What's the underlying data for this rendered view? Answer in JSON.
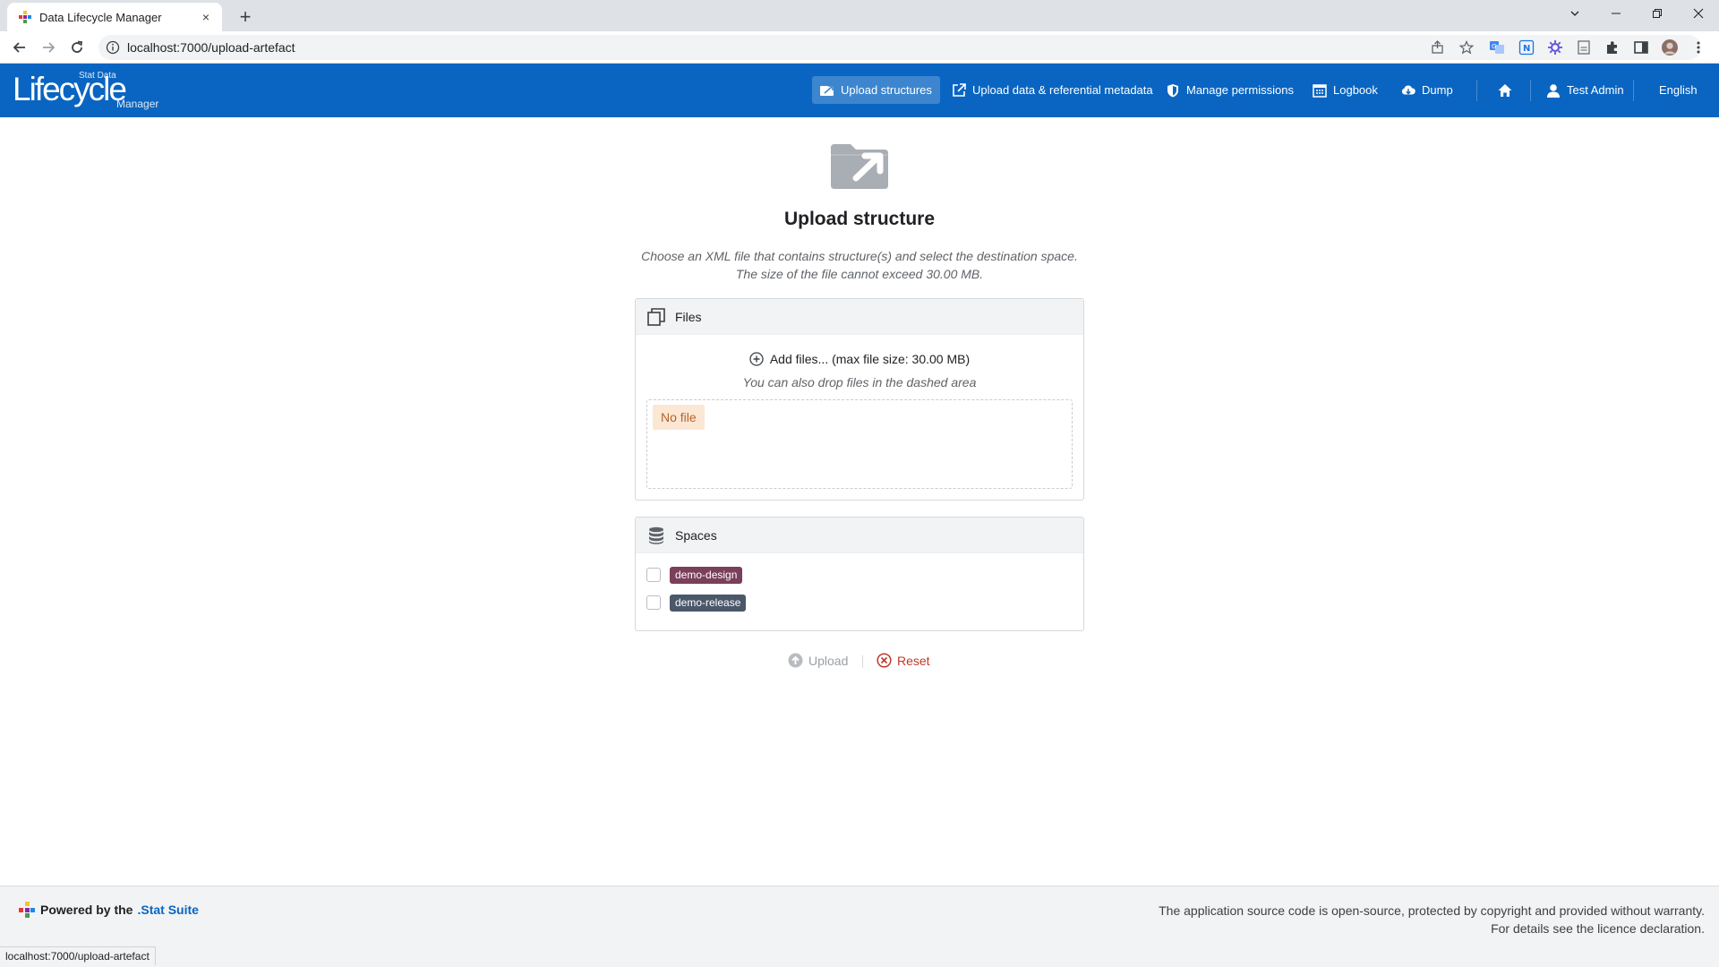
{
  "browser": {
    "tab_title": "Data Lifecycle Manager",
    "tab_close": "×",
    "new_tab": "+",
    "url": "localhost:7000/upload-artefact",
    "status_url": "localhost:7000/upload-artefact"
  },
  "app": {
    "logo": {
      "small": "Stat Data",
      "main": "Lifecycle",
      "sub": "Manager"
    },
    "nav": [
      {
        "label": "Upload structures",
        "icon": "upload-structure-icon",
        "active": true
      },
      {
        "label": "Upload data & referential metadata",
        "icon": "external-upload-icon",
        "active": false
      },
      {
        "label": "Manage permissions",
        "icon": "shield-icon",
        "active": false
      },
      {
        "label": "Logbook",
        "icon": "calendar-grid-icon",
        "active": false
      },
      {
        "label": "Dump",
        "icon": "cloud-download-icon",
        "active": false
      },
      {
        "label": "",
        "icon": "home-icon",
        "active": false
      },
      {
        "label": "Test Admin",
        "icon": "user-icon",
        "active": false
      },
      {
        "label": "English",
        "icon": "",
        "active": false
      }
    ]
  },
  "main": {
    "title": "Upload structure",
    "description_line1": "Choose an XML file that contains structure(s) and select the destination space.",
    "description_line2": "The size of the file cannot exceed 30.00 MB.",
    "files": {
      "header": "Files",
      "add_files": "Add files... (max file size: 30.00 MB)",
      "drop_hint": "You can also drop files in the dashed area",
      "no_file": "No file"
    },
    "spaces": {
      "header": "Spaces",
      "items": [
        {
          "label": "demo-design",
          "color": "#7a3f5a",
          "checked": false
        },
        {
          "label": "demo-release",
          "color": "#4a5869",
          "checked": false
        }
      ]
    },
    "actions": {
      "upload": "Upload",
      "reset": "Reset"
    }
  },
  "footer": {
    "powered_prefix": "Powered by the",
    "powered_brand": ".Stat Suite",
    "legal_line1": "The application source code is open-source, protected by copyright and provided without warranty.",
    "legal_line2": "For details see the licence declaration."
  },
  "colors": {
    "brand_blue": "#0965c1",
    "active_nav": "#3d86cf",
    "reset_red": "#c0392b",
    "upload_disabled": "#9aa0a6",
    "no_file_bg": "#fbe7d4"
  }
}
